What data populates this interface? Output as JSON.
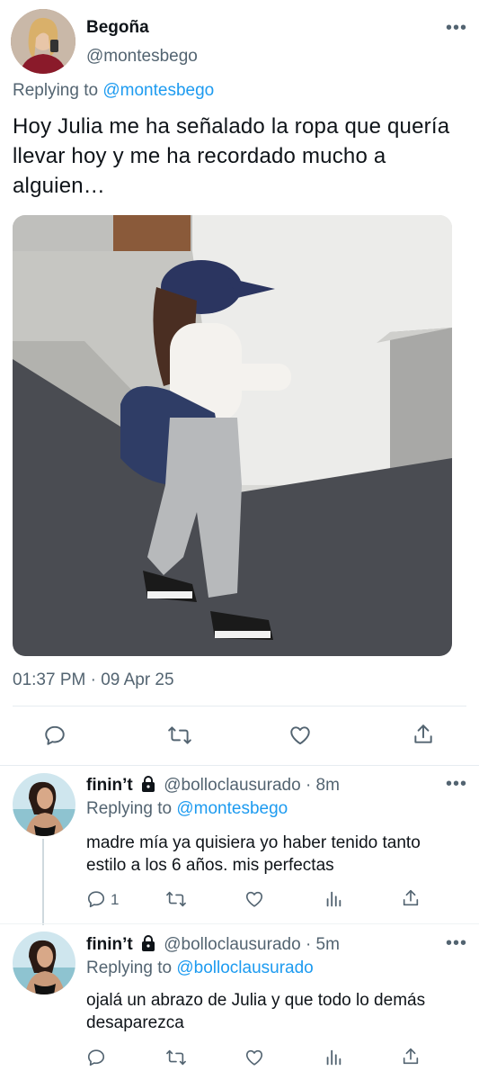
{
  "main_tweet": {
    "author_name": "Begoña",
    "author_handle": "@montesbego",
    "replying_prefix": "Replying to",
    "replying_to": "@montesbego",
    "text": "Hoy Julia me ha señalado la ropa que quería llevar hoy y me ha recordado mucho a alguien…",
    "timestamp": "01:37 PM · 09 Apr 25",
    "more_icon": "more-horizontal-icon"
  },
  "actions": {
    "icons": [
      "reply-icon",
      "retweet-icon",
      "like-icon",
      "share-icon"
    ]
  },
  "replies": [
    {
      "author_name": "finin’t",
      "author_handle": "@bolloclausurado",
      "time": "8m",
      "replying_prefix": "Replying to",
      "replying_to": "@montesbego",
      "text": "madre mía ya quisiera yo haber tenido tanto estilo a los 6 años. mis perfectas",
      "reply_count": "1"
    },
    {
      "author_name": "finin’t",
      "author_handle": "@bolloclausurado",
      "time": "5m",
      "replying_prefix": "Replying to",
      "replying_to": "@bolloclausurado",
      "text": "ojalá un abrazo de Julia y que todo lo demás desaparezca",
      "reply_count": ""
    }
  ],
  "colors": {
    "link": "#1d9bf0",
    "muted": "#536471",
    "text": "#0f1419",
    "divider": "#eff3f4"
  }
}
